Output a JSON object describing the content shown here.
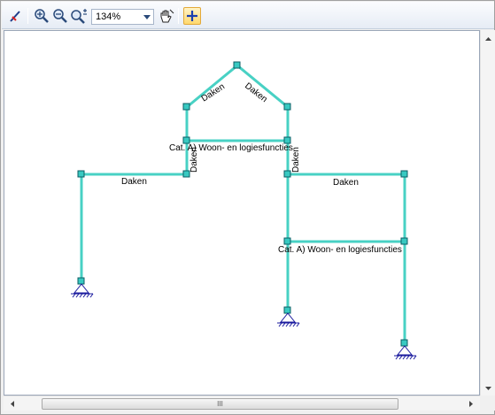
{
  "toolbar": {
    "tools": [
      {
        "name": "pencil-tool"
      },
      {
        "name": "zoom-in"
      },
      {
        "name": "zoom-out"
      },
      {
        "name": "zoom-fit"
      },
      {
        "name": "pan-hand"
      },
      {
        "name": "add-node"
      }
    ],
    "zoom_value": "134%"
  },
  "drawing": {
    "line_color": "#48d1c4",
    "node_color": "#38c9c1",
    "support_color": "#1a1a9e",
    "labels": {
      "roof_left": "Daken",
      "roof_right": "Daken",
      "wall_left": "Daken",
      "wall_right": "Daken",
      "floor_upper": "Cat. A) Woon- en logiesfuncties",
      "beam_left": "Daken",
      "beam_right": "Daken",
      "floor_lower": "Cat. A) Woon- en logiesfuncties"
    }
  },
  "scrollbars": {
    "h_thumb_grip": "III"
  }
}
